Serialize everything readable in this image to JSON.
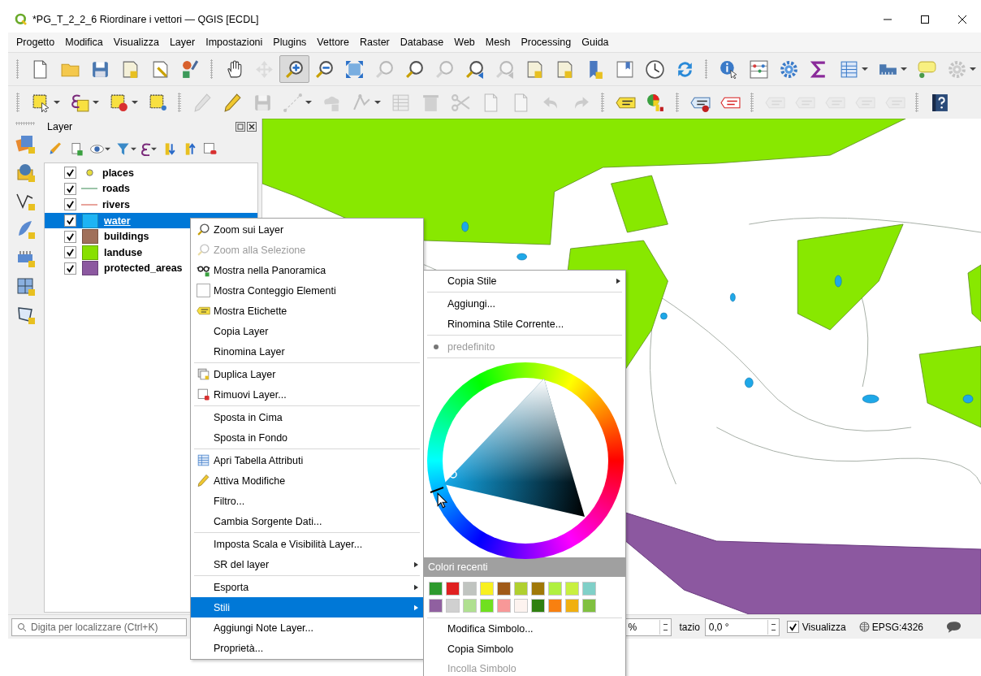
{
  "window": {
    "title": "*PG_T_2_2_6 Riordinare i vettori — QGIS [ECDL]"
  },
  "menu_bar": [
    "Progetto",
    "Modifica",
    "Visualizza",
    "Layer",
    "Impostazioni",
    "Plugins",
    "Vettore",
    "Raster",
    "Database",
    "Web",
    "Mesh",
    "Processing",
    "Guida"
  ],
  "toolbars": [
    {
      "groups": [
        [
          {
            "disabled": false,
            "pressed": false,
            "dropdown": false
          },
          {
            "disabled": false,
            "pressed": false,
            "dropdown": false
          },
          {
            "disabled": false,
            "pressed": false,
            "dropdown": false
          },
          {
            "disabled": false,
            "pressed": false,
            "dropdown": false
          },
          {
            "disabled": false,
            "pressed": false,
            "dropdown": false
          },
          {
            "disabled": false,
            "pressed": false,
            "dropdown": false
          }
        ],
        [
          {
            "disabled": false,
            "pressed": false,
            "dropdown": false
          },
          {
            "disabled": true,
            "pressed": false,
            "dropdown": false
          },
          {
            "disabled": false,
            "pressed": true,
            "dropdown": false
          },
          {
            "disabled": false,
            "pressed": false,
            "dropdown": false
          },
          {
            "disabled": false,
            "pressed": false,
            "dropdown": false
          },
          {
            "disabled": true,
            "pressed": false,
            "dropdown": false
          },
          {
            "disabled": false,
            "pressed": false,
            "dropdown": false
          },
          {
            "disabled": true,
            "pressed": false,
            "dropdown": false
          },
          {
            "disabled": false,
            "pressed": false,
            "dropdown": false
          },
          {
            "disabled": true,
            "pressed": false,
            "dropdown": false
          },
          {
            "disabled": false,
            "pressed": false,
            "dropdown": false
          },
          {
            "disabled": false,
            "pressed": false,
            "dropdown": false
          },
          {
            "disabled": false,
            "pressed": false,
            "dropdown": false
          },
          {
            "disabled": false,
            "pressed": false,
            "dropdown": false
          },
          {
            "disabled": false,
            "pressed": false,
            "dropdown": false
          },
          {
            "disabled": false,
            "pressed": false,
            "dropdown": false
          }
        ],
        [
          {
            "disabled": false,
            "pressed": false,
            "dropdown": false
          },
          {
            "disabled": false,
            "pressed": false,
            "dropdown": false
          },
          {
            "disabled": false,
            "pressed": false,
            "dropdown": false
          },
          {
            "disabled": false,
            "pressed": false,
            "dropdown": false
          },
          {
            "disabled": false,
            "pressed": false,
            "dropdown": true
          },
          {
            "disabled": false,
            "pressed": false,
            "dropdown": true
          },
          {
            "disabled": false,
            "pressed": false,
            "dropdown": false
          },
          {
            "disabled": true,
            "pressed": false,
            "dropdown": true
          }
        ]
      ]
    },
    {
      "groups": [
        [
          {
            "disabled": false,
            "pressed": false,
            "dropdown": true
          },
          {
            "disabled": false,
            "pressed": false,
            "dropdown": true
          },
          {
            "disabled": false,
            "pressed": false,
            "dropdown": true
          },
          {
            "disabled": false,
            "pressed": false,
            "dropdown": false
          }
        ],
        [
          {
            "disabled": true,
            "pressed": false,
            "dropdown": false
          },
          {
            "disabled": false,
            "pressed": false,
            "dropdown": false
          },
          {
            "disabled": true,
            "pressed": false,
            "dropdown": false
          },
          {
            "disabled": true,
            "pressed": false,
            "dropdown": true
          },
          {
            "disabled": true,
            "pressed": false,
            "dropdown": false
          },
          {
            "disabled": true,
            "pressed": false,
            "dropdown": true
          },
          {
            "disabled": true,
            "pressed": false,
            "dropdown": false
          },
          {
            "disabled": true,
            "pressed": false,
            "dropdown": false
          },
          {
            "disabled": true,
            "pressed": false,
            "dropdown": false
          },
          {
            "disabled": true,
            "pressed": false,
            "dropdown": false
          },
          {
            "disabled": true,
            "pressed": false,
            "dropdown": false
          },
          {
            "disabled": true,
            "pressed": false,
            "dropdown": false
          },
          {
            "disabled": true,
            "pressed": false,
            "dropdown": false
          }
        ],
        [
          {
            "disabled": false,
            "pressed": false,
            "dropdown": false
          },
          {
            "disabled": false,
            "pressed": false,
            "dropdown": false
          }
        ],
        [
          {
            "disabled": false,
            "pressed": false,
            "dropdown": false
          },
          {
            "disabled": false,
            "pressed": false,
            "dropdown": false
          }
        ],
        [
          {
            "disabled": true,
            "pressed": false,
            "dropdown": false
          },
          {
            "disabled": true,
            "pressed": false,
            "dropdown": false
          },
          {
            "disabled": true,
            "pressed": false,
            "dropdown": false
          },
          {
            "disabled": true,
            "pressed": false,
            "dropdown": false
          },
          {
            "disabled": true,
            "pressed": false,
            "dropdown": false
          }
        ],
        [
          {
            "disabled": false,
            "pressed": false,
            "dropdown": false
          }
        ]
      ]
    }
  ],
  "layers_panel": {
    "title": "Layer",
    "layers": [
      {
        "name": "places",
        "checked": true,
        "selected": false,
        "kind": "point",
        "color": "#e6dc3c"
      },
      {
        "name": "roads",
        "checked": true,
        "selected": false,
        "kind": "line",
        "color": "#9cc4a8"
      },
      {
        "name": "rivers",
        "checked": true,
        "selected": false,
        "kind": "line",
        "color": "#e8a49c"
      },
      {
        "name": "water",
        "checked": true,
        "selected": true,
        "kind": "fill",
        "color": "#1eb4f4"
      },
      {
        "name": "buildings",
        "checked": true,
        "selected": false,
        "kind": "fill",
        "color": "#a0705a"
      },
      {
        "name": "landuse",
        "checked": true,
        "selected": false,
        "kind": "fill",
        "color": "#88e000"
      },
      {
        "name": "protected_areas",
        "checked": true,
        "selected": false,
        "kind": "fill",
        "color": "#8c58a0"
      }
    ]
  },
  "context_menu": {
    "sections": [
      [
        {
          "label": "Zoom sui Layer",
          "disabled": false,
          "selected": false,
          "submenu": false
        },
        {
          "label": "Zoom alla Selezione",
          "disabled": true,
          "selected": false,
          "submenu": false
        },
        {
          "label": "Mostra nella Panoramica",
          "disabled": false,
          "selected": false,
          "submenu": false
        },
        {
          "label": "Mostra Conteggio Elementi",
          "kind": "checkbox",
          "checked": false,
          "disabled": false,
          "selected": false,
          "submenu": false
        },
        {
          "label": "Mostra Etichette",
          "disabled": false,
          "selected": false,
          "submenu": false
        },
        {
          "label": "Copia Layer",
          "disabled": false,
          "selected": false,
          "submenu": false
        },
        {
          "label": "Rinomina Layer",
          "disabled": false,
          "selected": false,
          "submenu": false
        }
      ],
      [
        {
          "label": "Duplica Layer",
          "disabled": false,
          "selected": false,
          "submenu": false
        },
        {
          "label": "Rimuovi Layer...",
          "disabled": false,
          "selected": false,
          "submenu": false
        }
      ],
      [
        {
          "label": "Sposta in Cima",
          "disabled": false,
          "selected": false,
          "submenu": false
        },
        {
          "label": "Sposta in Fondo",
          "disabled": false,
          "selected": false,
          "submenu": false
        }
      ],
      [
        {
          "label": "Apri Tabella Attributi",
          "disabled": false,
          "selected": false,
          "submenu": false
        },
        {
          "label": "Attiva Modifiche",
          "disabled": false,
          "selected": false,
          "submenu": false
        },
        {
          "label": "Filtro...",
          "disabled": false,
          "selected": false,
          "submenu": false
        },
        {
          "label": "Cambia Sorgente Dati...",
          "disabled": false,
          "selected": false,
          "submenu": false
        }
      ],
      [
        {
          "label": "Imposta Scala e Visibilità Layer...",
          "disabled": false,
          "selected": false,
          "submenu": false
        },
        {
          "label": "SR del layer",
          "disabled": false,
          "selected": false,
          "submenu": true
        }
      ],
      [
        {
          "label": "Esporta",
          "disabled": false,
          "selected": false,
          "submenu": true
        },
        {
          "label": "Stili",
          "disabled": false,
          "selected": true,
          "submenu": true
        },
        {
          "label": "Aggiungi Note Layer...",
          "disabled": false,
          "selected": false,
          "submenu": false
        },
        {
          "label": "Proprietà...",
          "disabled": false,
          "selected": false,
          "submenu": false
        }
      ]
    ]
  },
  "styles_submenu": {
    "top_sections": [
      [
        {
          "label": "Copia Stile",
          "disabled": false,
          "submenu": true
        }
      ],
      [
        {
          "label": "Aggiungi...",
          "disabled": false,
          "submenu": false
        },
        {
          "label": "Rinomina Stile Corrente...",
          "disabled": false,
          "submenu": false
        }
      ],
      [
        {
          "label": "predefinito",
          "kind": "radio",
          "checked": true,
          "disabled": true,
          "submenu": false
        }
      ]
    ],
    "recent_colors_title": "Colori recenti",
    "recent_colors": [
      {
        "color": "#2e9a2e"
      },
      {
        "color": "#e02020"
      },
      {
        "color": "#c0c4c0"
      },
      {
        "color": "#f8f020"
      },
      {
        "color": "#a05a18"
      },
      {
        "color": "#b0d030"
      },
      {
        "color": "#a07808"
      },
      {
        "color": "#b0f040"
      },
      {
        "color": "#c8f040"
      },
      {
        "color": "#80d0c8"
      },
      {
        "color": "#9060a0"
      },
      {
        "color": "#d0d0d0"
      },
      {
        "color": "#b0e090"
      },
      {
        "color": "#70e020"
      },
      {
        "color": "#f89898"
      },
      {
        "color": "#fdf3ef"
      },
      {
        "color": "#308010"
      },
      {
        "color": "#f88010"
      },
      {
        "color": "#f0b010"
      },
      {
        "color": "#80c040"
      }
    ],
    "bottom_items": [
      {
        "label": "Modifica Simbolo...",
        "disabled": false
      },
      {
        "label": "Copia Simbolo",
        "disabled": false
      },
      {
        "label": "Incolla Simbolo",
        "disabled": true
      }
    ]
  },
  "status_bar": {
    "search_placeholder": "Digita per localizzare (Ctrl+K)",
    "magnifier_value": "%",
    "rotation_label": "tazio",
    "rotation_value": "0,0 °",
    "render_checked": true,
    "render_label": "Visualizza",
    "crs": "EPSG:4326"
  }
}
